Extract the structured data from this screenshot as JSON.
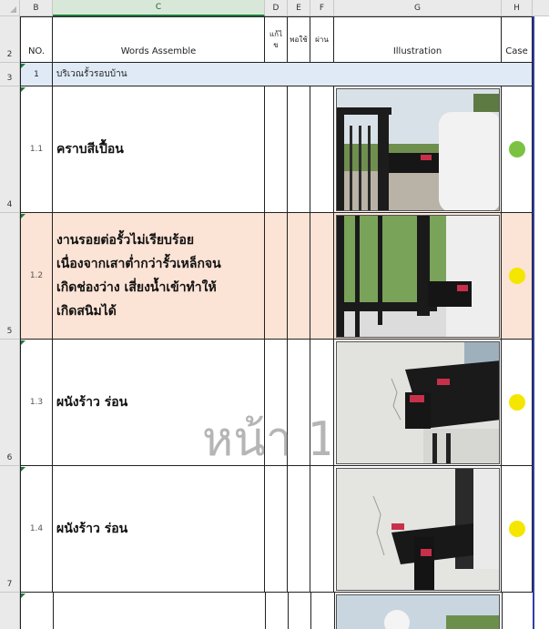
{
  "columns": {
    "b": "B",
    "c": "C",
    "d": "D",
    "e": "E",
    "f": "F",
    "g": "G",
    "h": "H"
  },
  "row_numbers": [
    "2",
    "3",
    "4",
    "5",
    "6",
    "7"
  ],
  "header": {
    "no": "NO.",
    "words": "Words Assemble",
    "fix_line1": "แก้ไ",
    "fix_line2": "ข",
    "ok": "พอใช้",
    "pass": "ผ่าน",
    "illustration": "Illustration",
    "case": "Case"
  },
  "section": {
    "no": "1",
    "title": "บริเวณรั้วรอบบ้าน"
  },
  "items": [
    {
      "no": "1.1",
      "lines": [
        "คราบสีเปื้อน"
      ],
      "case_color": "#7cc242",
      "highlight": false
    },
    {
      "no": "1.2",
      "lines": [
        "งานรอยต่อรั้วไม่เรียบร้อย",
        "เนื่องจากเสาต่ำกว่ารั้วเหล็กจน",
        "เกิดช่องว่าง เสี่ยงน้ำเข้าทำให้",
        "เกิดสนิมได้"
      ],
      "case_color": "#f5e600",
      "highlight": true
    },
    {
      "no": "1.3",
      "lines": [
        "ผนังร้าว ร่อน"
      ],
      "case_color": "#f5e600",
      "highlight": false
    },
    {
      "no": "1.4",
      "lines": [
        "ผนังร้าว ร่อน"
      ],
      "case_color": "#f5e600",
      "highlight": false
    }
  ],
  "watermark": "หน้า 1",
  "colors": {
    "highlight_row": "#fbe3d5",
    "section_row": "#dfeaf6",
    "border_right": "#2f3fa8"
  }
}
